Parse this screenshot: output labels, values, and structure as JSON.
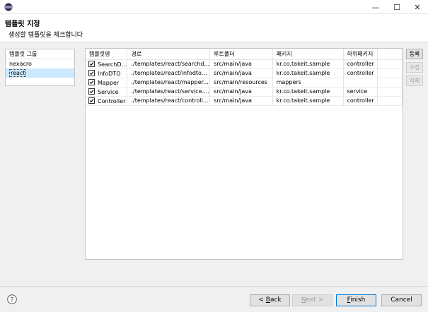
{
  "window": {
    "minimize": "—",
    "maximize": "☐",
    "close": "✕"
  },
  "header": {
    "title": "템플릿 지정",
    "description": "생성할 템플릿을 체크합니다"
  },
  "group_panel": {
    "header": "템플릿 그룹",
    "items": [
      {
        "label": "nexacro"
      },
      {
        "label": "react",
        "selected": true
      }
    ]
  },
  "table": {
    "columns": [
      "템플릿명",
      "경로",
      "루트폴더",
      "패키지",
      "하위패키지"
    ],
    "rows": [
      {
        "checked": true,
        "name": "SearchD...",
        "path": "./templates/react/searchd...",
        "root": "src/main/java",
        "package": "kr.co.takeit.sample",
        "subpackage": "controller"
      },
      {
        "checked": true,
        "name": "InfoDTO",
        "path": "./templates/react/infodto...",
        "root": "src/main/java",
        "package": "kr.co.takeit.sample",
        "subpackage": "controller"
      },
      {
        "checked": true,
        "name": "Mapper",
        "path": "./templates/react/mapper...",
        "root": "src/main/resources",
        "package": "mappers",
        "subpackage": ""
      },
      {
        "checked": true,
        "name": "Service",
        "path": "./templates/react/service....",
        "root": "src/main/java",
        "package": "kr.co.takeit.sample",
        "subpackage": "service"
      },
      {
        "checked": true,
        "name": "Controller",
        "path": "./templates/react/controll...",
        "root": "src/main/java",
        "package": "kr.co.takeit.sample",
        "subpackage": "controller"
      }
    ]
  },
  "side_buttons": {
    "register": "등록",
    "edit": "수정",
    "delete": "삭제"
  },
  "footer": {
    "back": {
      "mnemonic": "B",
      "rest": "ack",
      "prefix": "< "
    },
    "next": {
      "mnemonic": "N",
      "rest": "ext >"
    },
    "finish": {
      "mnemonic": "F",
      "rest": "inish"
    },
    "cancel": "Cancel"
  },
  "colors": {
    "selection": "#cce8ff",
    "primary_border": "#0078d7"
  }
}
